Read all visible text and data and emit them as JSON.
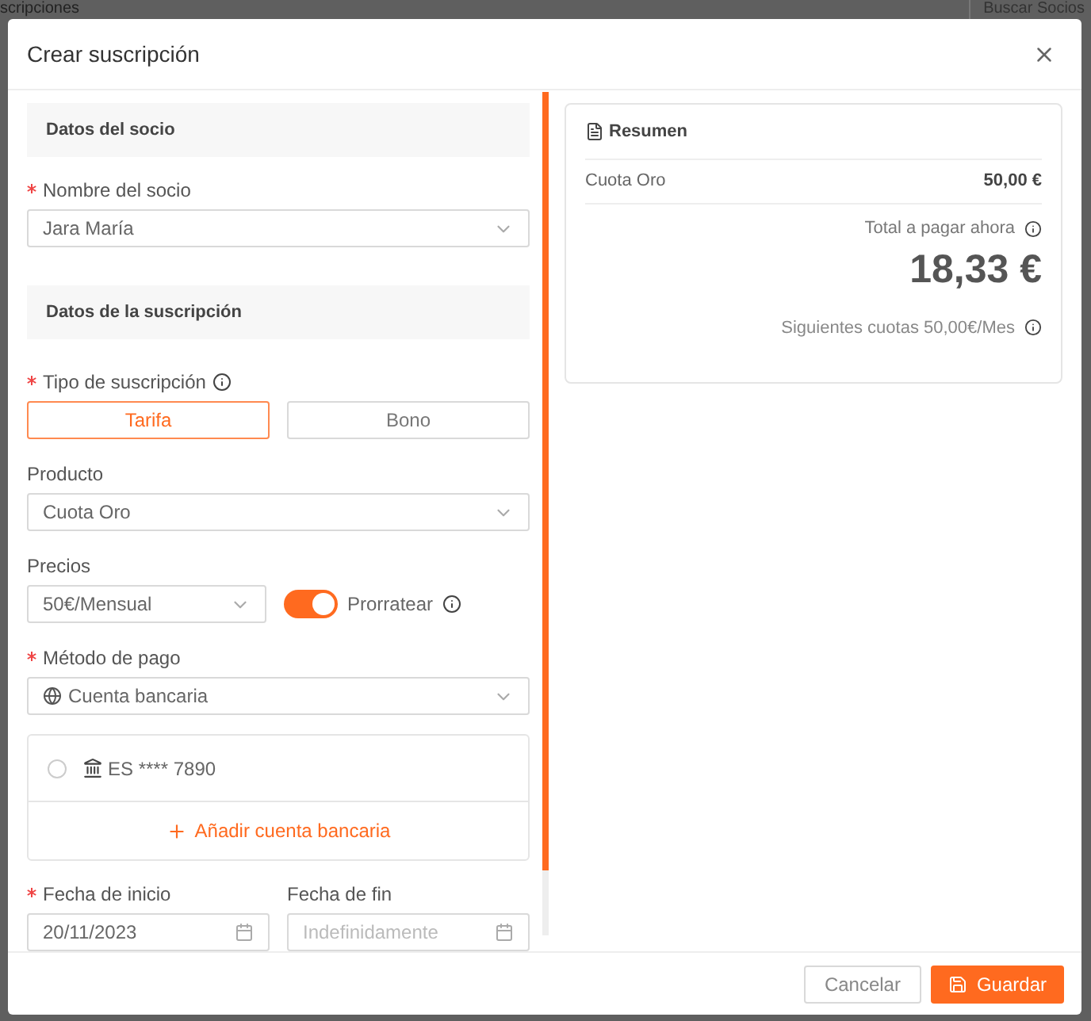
{
  "background": {
    "title_fragment": "scripciones",
    "search_placeholder": "Buscar Socios"
  },
  "dialog": {
    "title": "Crear suscripción"
  },
  "member_section": {
    "title": "Datos del socio"
  },
  "member_field": {
    "label": "Nombre del socio",
    "required": true,
    "value": "Jara María"
  },
  "subscription_section": {
    "title": "Datos de la suscripción"
  },
  "subscription_type": {
    "label": "Tipo de suscripción",
    "required": true,
    "options": [
      {
        "label": "Tarifa",
        "selected": true
      },
      {
        "label": "Bono",
        "selected": false
      }
    ]
  },
  "product": {
    "label": "Producto",
    "required": false,
    "value": "Cuota Oro"
  },
  "prices": {
    "label": "Precios",
    "required": false,
    "value": "50€/Mensual"
  },
  "prorate": {
    "label": "Prorratear",
    "on": true
  },
  "payment_method": {
    "label": "Método de pago",
    "required": true,
    "value": "Cuenta bancaria"
  },
  "bank_accounts": [
    {
      "label": "ES **** 7890",
      "selected": false
    }
  ],
  "add_account": "Añadir cuenta bancaria",
  "start_date": {
    "label": "Fecha de inicio",
    "required": true,
    "value": "20/11/2023"
  },
  "end_date": {
    "label": "Fecha de fin",
    "required": false,
    "placeholder": "Indefinidamente"
  },
  "summary": {
    "title": "Resumen",
    "items": [
      {
        "name": "Cuota Oro",
        "amount": "50,00 €"
      }
    ],
    "total_label": "Total a pagar ahora",
    "total": "18,33 €",
    "next_fees": "Siguientes cuotas 50,00€/Mes"
  },
  "footer": {
    "cancel": "Cancelar",
    "save": "Guardar"
  }
}
